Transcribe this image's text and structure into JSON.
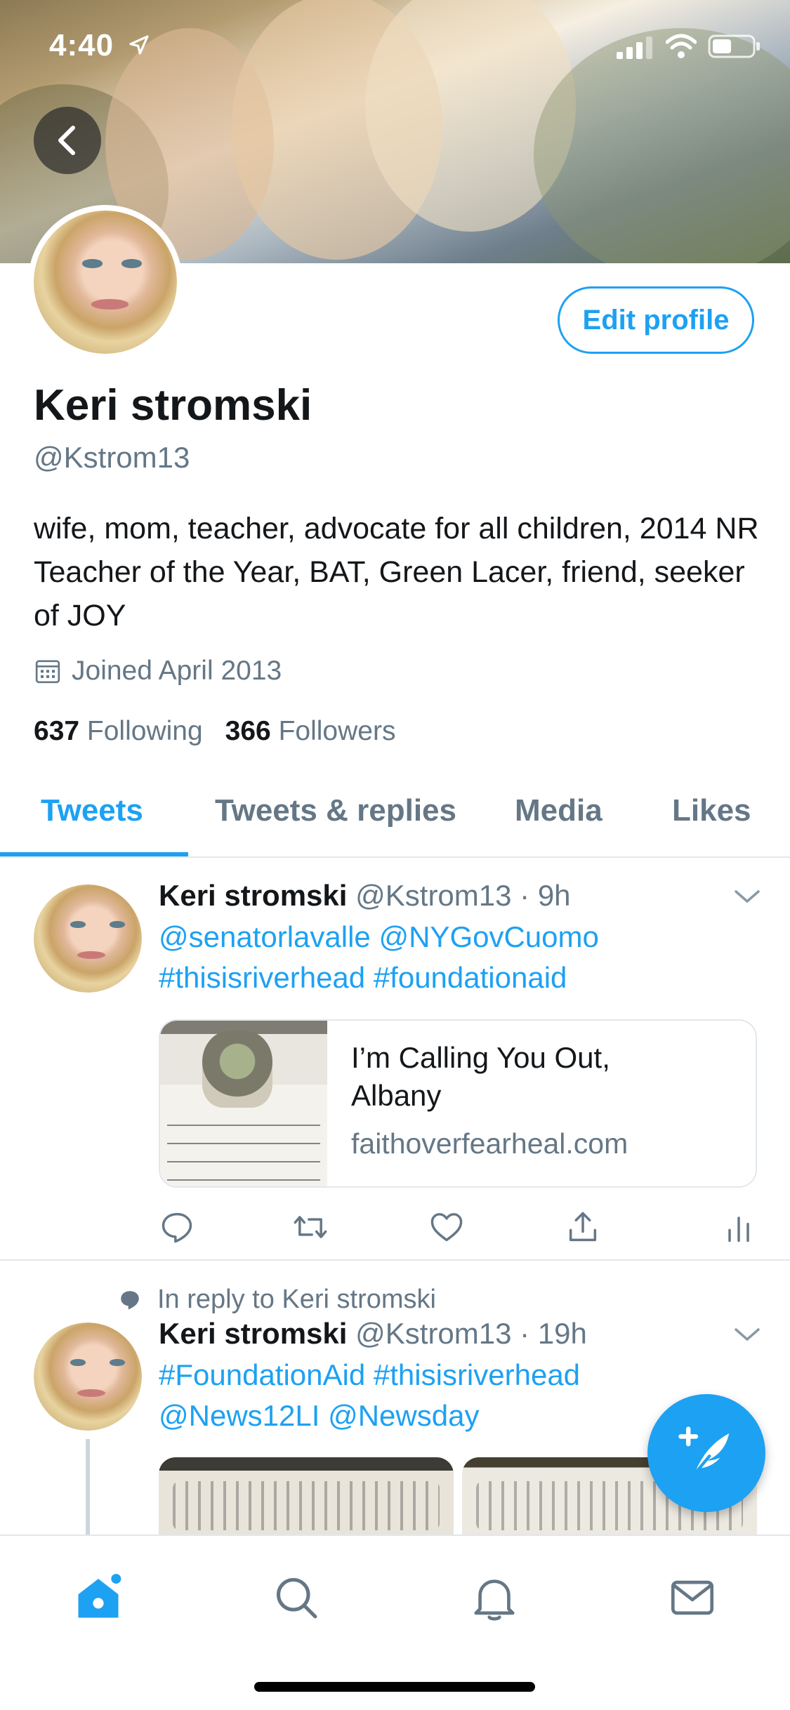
{
  "status_bar": {
    "time": "4:40"
  },
  "profile": {
    "name": "Keri stromski",
    "handle": "@Kstrom13",
    "bio": "wife, mom, teacher, advocate for all children, 2014 NR Teacher of the Year, BAT, Green Lacer, friend, seeker of JOY",
    "joined": "Joined April 2013",
    "following_count": "637",
    "following_label": "Following",
    "followers_count": "366",
    "followers_label": "Followers",
    "edit_profile_label": "Edit profile"
  },
  "tabs": [
    {
      "label": "Tweets",
      "active": true
    },
    {
      "label": "Tweets & replies",
      "active": false
    },
    {
      "label": "Media",
      "active": false
    },
    {
      "label": "Likes",
      "active": false
    }
  ],
  "tweets": [
    {
      "name": "Keri stromski",
      "meta": "@Kstrom13 · 9h",
      "text_line1": "@senatorlavalle @NYGovCuomo",
      "text_line2": "#thisisriverhead #foundationaid",
      "card": {
        "title": "I’m Calling You Out, Albany",
        "domain": "faithoverfearheal.com"
      }
    },
    {
      "reply_context": "In reply to Keri stromski",
      "name": "Keri stromski",
      "meta": "@Kstrom13 · 19h",
      "text_line1": "#FoundationAid #thisisriverhead",
      "text_line2": "@News12LI @Newsday"
    }
  ],
  "colors": {
    "accent": "#1da1f2",
    "secondary_text": "#657786",
    "primary_text": "#14171a",
    "divider": "#e1e8ed"
  },
  "icons": {
    "status": [
      "location-arrow-icon",
      "signal-icon",
      "wifi-icon",
      "battery-icon"
    ],
    "header": [
      "back-arrow-icon"
    ],
    "actions": [
      "reply-icon",
      "retweet-icon",
      "like-icon",
      "share-icon",
      "analytics-icon"
    ],
    "nav": [
      "home-icon",
      "search-icon",
      "notifications-icon",
      "messages-icon"
    ],
    "fab": "compose-tweet-icon"
  }
}
